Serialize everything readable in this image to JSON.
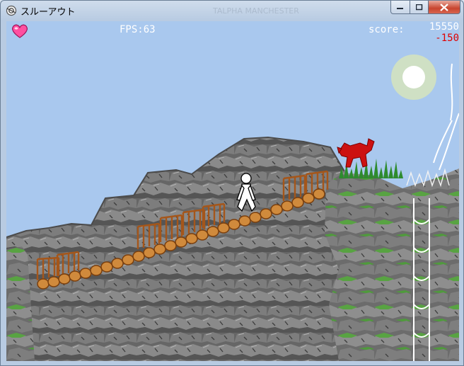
{
  "window": {
    "title": "スルーアウト",
    "background_title": "TALPHA MANCHESTER",
    "controls": {
      "minimize": "minimize",
      "maximize": "maximize",
      "close": "close"
    }
  },
  "hud": {
    "hearts": [
      {
        "icon": "heart-icon",
        "color": "#ff4fa0"
      },
      {
        "icon": "heart-icon",
        "color": "#ff4fa0"
      },
      {
        "icon": "heart-icon",
        "color": "#ff4fa0"
      },
      {
        "icon": "heart-icon",
        "color": "#ff4fa0"
      },
      {
        "icon": "heart-icon",
        "color": "#ff4fa0"
      }
    ],
    "fps": "FPS:63",
    "score_label": "score:",
    "score_value": "15550",
    "score_delta": "-150"
  },
  "colors": {
    "sky": "#a9c8ee",
    "rock": "#6f6f6f",
    "bridge": "#c8731f",
    "wolf": "#cc1111",
    "grass": "#2e8b2e",
    "heart": "#ff4fa0"
  }
}
